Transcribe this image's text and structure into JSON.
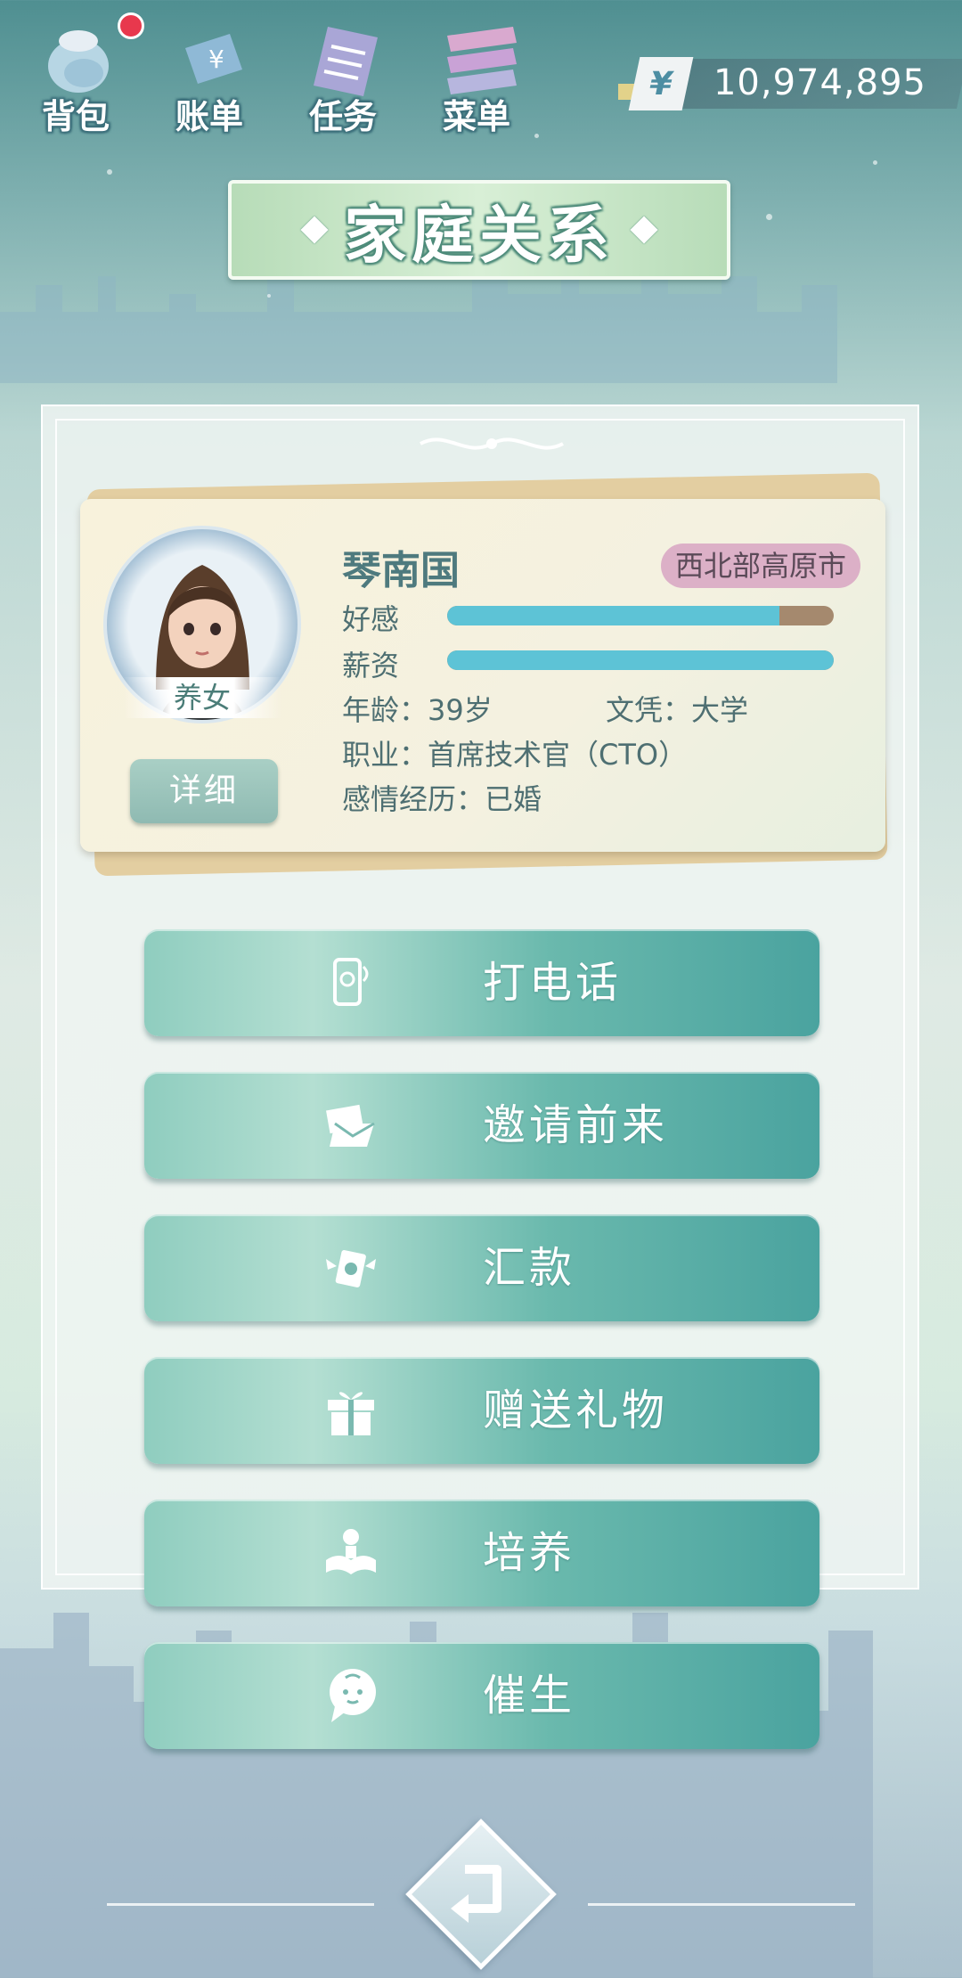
{
  "topnav": {
    "items": [
      {
        "label": "背包",
        "icon": "backpack-icon",
        "has_badge": true
      },
      {
        "label": "账单",
        "icon": "bill-icon",
        "has_badge": false
      },
      {
        "label": "任务",
        "icon": "task-icon",
        "has_badge": false
      },
      {
        "label": "菜单",
        "icon": "menu-icon",
        "has_badge": false
      }
    ]
  },
  "money": {
    "currency_symbol": "¥",
    "value": "10,974,895"
  },
  "title": "家庭关系",
  "profile": {
    "name": "琴南国",
    "region": "西北部高原市",
    "relation": "养女",
    "detail_label": "详细",
    "favor_label": "好感",
    "favor_level": 0.86,
    "salary_label": "薪资",
    "salary_level": 1.0,
    "age": "年龄：39岁",
    "education": "文凭：大学",
    "job": "职业：首席技术官（CTO）",
    "relationship": "感情经历：已婚"
  },
  "actions": [
    {
      "label": "打电话",
      "icon": "phone-icon"
    },
    {
      "label": "邀请前来",
      "icon": "invitation-icon"
    },
    {
      "label": "汇款",
      "icon": "money-transfer-icon"
    },
    {
      "label": "赠送礼物",
      "icon": "gift-icon"
    },
    {
      "label": "培养",
      "icon": "study-icon"
    },
    {
      "label": "催生",
      "icon": "baby-bubble-icon"
    }
  ],
  "back": {
    "icon": "back-arrow-icon"
  },
  "colors": {
    "accent": "#5dc3d6",
    "button": "#6ab9ad",
    "title_banner": "#c8e6c6",
    "region_tag": "#dcb0c7"
  }
}
